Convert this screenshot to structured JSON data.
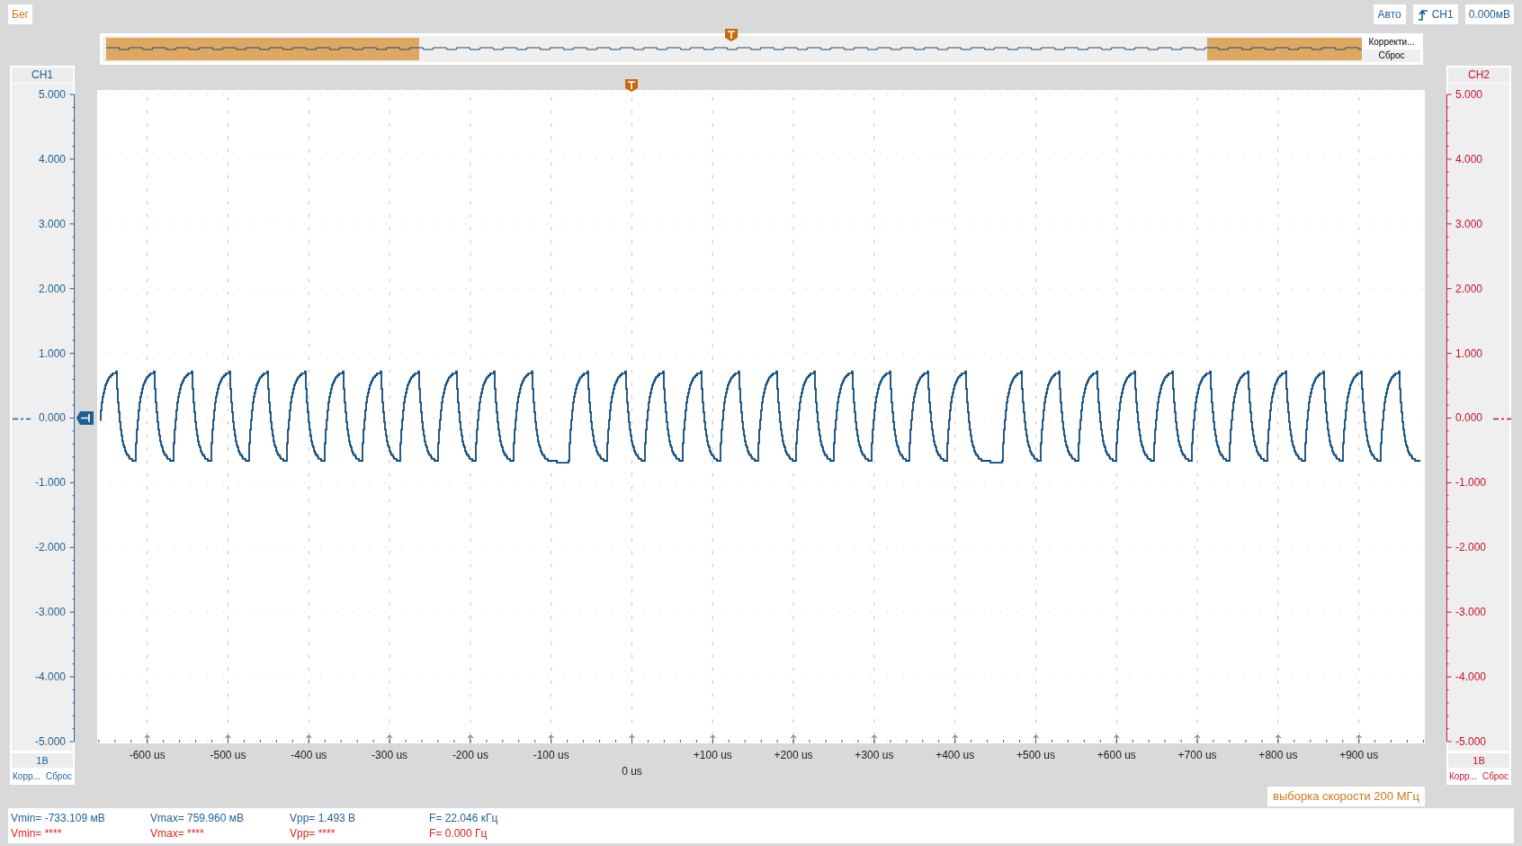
{
  "run_button": "Бег",
  "trigger": {
    "mode": "Авто",
    "source": "CH1",
    "level": "0.000мВ"
  },
  "overview": {
    "adjust_button": "Корректи...",
    "reset_button": "Сброс"
  },
  "channels": [
    {
      "kind": "left",
      "name": "CH1",
      "color": "#1f5f96",
      "scale": "1В",
      "adjust_button": "Корр...",
      "reset_button": "Сброс",
      "y_labels": [
        "5.000",
        "4.000",
        "3.000",
        "2.000",
        "1.000",
        "0.000",
        "-1.000",
        "-2.000",
        "-3.000",
        "-4.000",
        "-5.000"
      ]
    },
    {
      "kind": "right",
      "name": "CH2",
      "color": "#c8102e",
      "scale": "1В",
      "adjust_button": "Корр...",
      "reset_button": "Сброс",
      "y_labels": [
        "5.000",
        "4.000",
        "3.000",
        "2.000",
        "1.000",
        "0.000",
        "-1.000",
        "-2.000",
        "-3.000",
        "-4.000",
        "-5.000"
      ]
    }
  ],
  "x_labels": [
    {
      "kind": "tick",
      "text": "-600 us"
    },
    {
      "kind": "tick",
      "text": "-500 us"
    },
    {
      "kind": "tick",
      "text": "-400 us"
    },
    {
      "kind": "tick",
      "text": "-300 us"
    },
    {
      "kind": "tick",
      "text": "-200 us"
    },
    {
      "kind": "tick",
      "text": "-100 us"
    },
    {
      "kind": "origin",
      "text": "0 us"
    },
    {
      "kind": "tick",
      "text": "+100 us"
    },
    {
      "kind": "tick",
      "text": "+200 us"
    },
    {
      "kind": "tick",
      "text": "+300 us"
    },
    {
      "kind": "tick",
      "text": "+400 us"
    },
    {
      "kind": "tick",
      "text": "+500 us"
    },
    {
      "kind": "tick",
      "text": "+600 us"
    },
    {
      "kind": "tick",
      "text": "+700 us"
    },
    {
      "kind": "tick",
      "text": "+800 us"
    },
    {
      "kind": "tick",
      "text": "+900 us"
    }
  ],
  "sample_rate": "выборка скорости 200 МГц",
  "measurements": [
    {
      "color": "#1f5f96",
      "values": [
        "Vmin= -733.109 мВ",
        "Vmax= 759.960 мВ",
        "Vpp= 1.493 В",
        "F= 22.046 кГц"
      ]
    },
    {
      "color": "#e0201b",
      "values": [
        "Vmin= ****",
        "Vmax= ****",
        "Vpp= ****",
        "F= 0.000 Гц"
      ]
    }
  ]
}
